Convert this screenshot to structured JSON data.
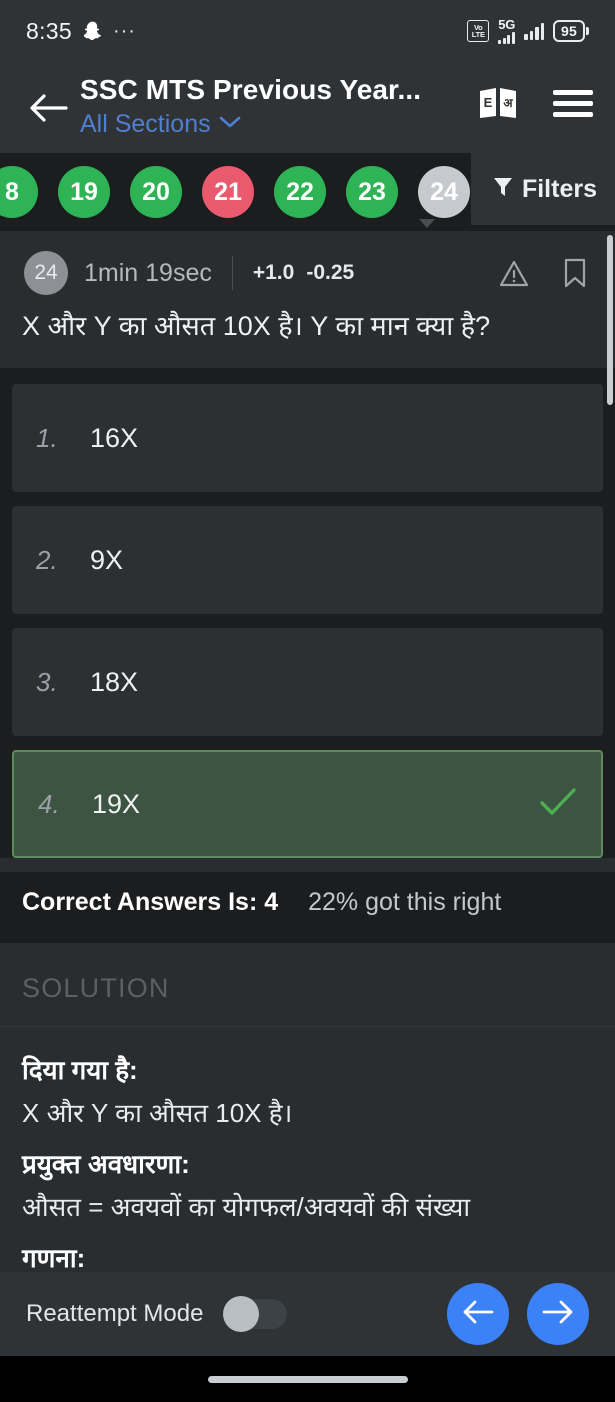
{
  "status_bar": {
    "time": "8:35",
    "snapchat_icon": "snapchat-ghost-icon",
    "more_dots": "···",
    "volte_line1": "Vo",
    "volte_line2": "LTE",
    "network": "5G",
    "battery_percent": "95"
  },
  "header": {
    "back_icon": "back-arrow-icon",
    "title": "SSC MTS Previous Year...",
    "subtitle": "All Sections",
    "subtitle_chevron": "chevron-down-icon",
    "language_icon_left": "E",
    "language_icon_right": "अ",
    "menu_icon": "hamburger-menu-icon"
  },
  "question_strip": {
    "chips": [
      {
        "label": "8",
        "state": "green",
        "partial": true
      },
      {
        "label": "19",
        "state": "green",
        "partial": false
      },
      {
        "label": "20",
        "state": "green",
        "partial": false
      },
      {
        "label": "21",
        "state": "red",
        "partial": false
      },
      {
        "label": "22",
        "state": "green",
        "partial": false
      },
      {
        "label": "23",
        "state": "green",
        "partial": false
      },
      {
        "label": "24",
        "state": "grey",
        "partial": false
      },
      {
        "label": "",
        "state": "grey",
        "partial": true
      }
    ],
    "filters_label": "Filters",
    "filters_icon": "filter-funnel-icon",
    "colors": {
      "green": "#2eb355",
      "red": "#ea5a6e",
      "grey": "#c6cace"
    }
  },
  "question": {
    "number_badge": "24",
    "time_taken": "1min 19sec",
    "positive_mark": "+1.0",
    "negative_mark": "-0.25",
    "report_icon": "warning-triangle-icon",
    "bookmark_icon": "bookmark-icon",
    "text": "X और Y का औसत 10X है। Y का मान क्या है?"
  },
  "options": [
    {
      "num": "1.",
      "text": "16X",
      "correct": false
    },
    {
      "num": "2.",
      "text": "9X",
      "correct": false
    },
    {
      "num": "3.",
      "text": "18X",
      "correct": false
    },
    {
      "num": "4.",
      "text": "19X",
      "correct": true
    }
  ],
  "answer_summary": {
    "label": "Correct Answers Is: 4",
    "stat": "22% got this right"
  },
  "solution": {
    "tab_label": "SOLUTION",
    "given_heading": "दिया गया है:",
    "given_text": "X और Y का औसत 10X है।",
    "concept_heading": "प्रयुक्त अवधारणा:",
    "concept_text": "औसत = अवयवों का योगफल/अवयवों की संख्या",
    "calc_heading": "गणना:"
  },
  "bottom_bar": {
    "reattempt_label": "Reattempt Mode",
    "toggle_state": "off",
    "prev_icon": "arrow-left-icon",
    "next_icon": "arrow-right-icon",
    "accent_color": "#3b82f6"
  }
}
